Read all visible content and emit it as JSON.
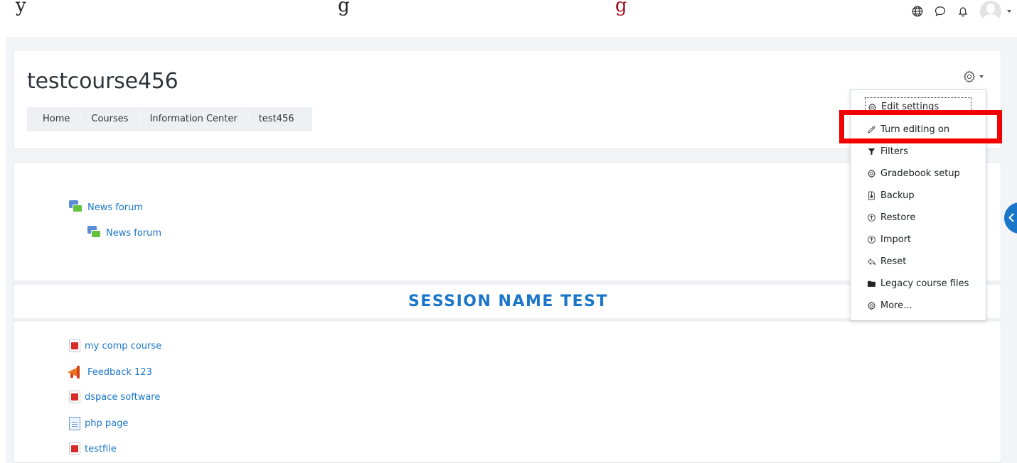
{
  "banner": {
    "text_plain": "y                                        g                                                       ",
    "text_red": "g"
  },
  "course": {
    "title": "testcourse456"
  },
  "breadcrumb": {
    "items": [
      "Home",
      "Courses",
      "Information Center",
      "test456"
    ]
  },
  "activities_top": [
    {
      "label": "News forum",
      "icon": "forum-icon"
    },
    {
      "label": "News forum",
      "icon": "forum-icon"
    }
  ],
  "section": {
    "title": "SESSION NAME TEST",
    "activities": [
      {
        "label": "my comp course",
        "icon": "pdf-icon"
      },
      {
        "label": "Feedback 123",
        "icon": "feedback-icon"
      },
      {
        "label": "dspace software",
        "icon": "pdf-icon"
      },
      {
        "label": "php page",
        "icon": "page-icon"
      },
      {
        "label": "testfile",
        "icon": "pdf-icon"
      }
    ]
  },
  "settings_menu": {
    "items": [
      {
        "label": "Edit settings",
        "icon": "gear-icon"
      },
      {
        "label": "Turn editing on",
        "icon": "pencil-icon"
      },
      {
        "label": "Filters",
        "icon": "filter-icon"
      },
      {
        "label": "Gradebook setup",
        "icon": "gear-icon"
      },
      {
        "label": "Backup",
        "icon": "file-archive-icon"
      },
      {
        "label": "Restore",
        "icon": "upload-circle-icon"
      },
      {
        "label": "Import",
        "icon": "upload-circle-icon"
      },
      {
        "label": "Reset",
        "icon": "reply-icon"
      },
      {
        "label": "Legacy course files",
        "icon": "folder-icon"
      },
      {
        "label": "More...",
        "icon": "gear-icon"
      }
    ]
  },
  "colors": {
    "accent": "#1a76c9",
    "highlight": "#f40000",
    "page_bg": "#f2f4f7"
  }
}
